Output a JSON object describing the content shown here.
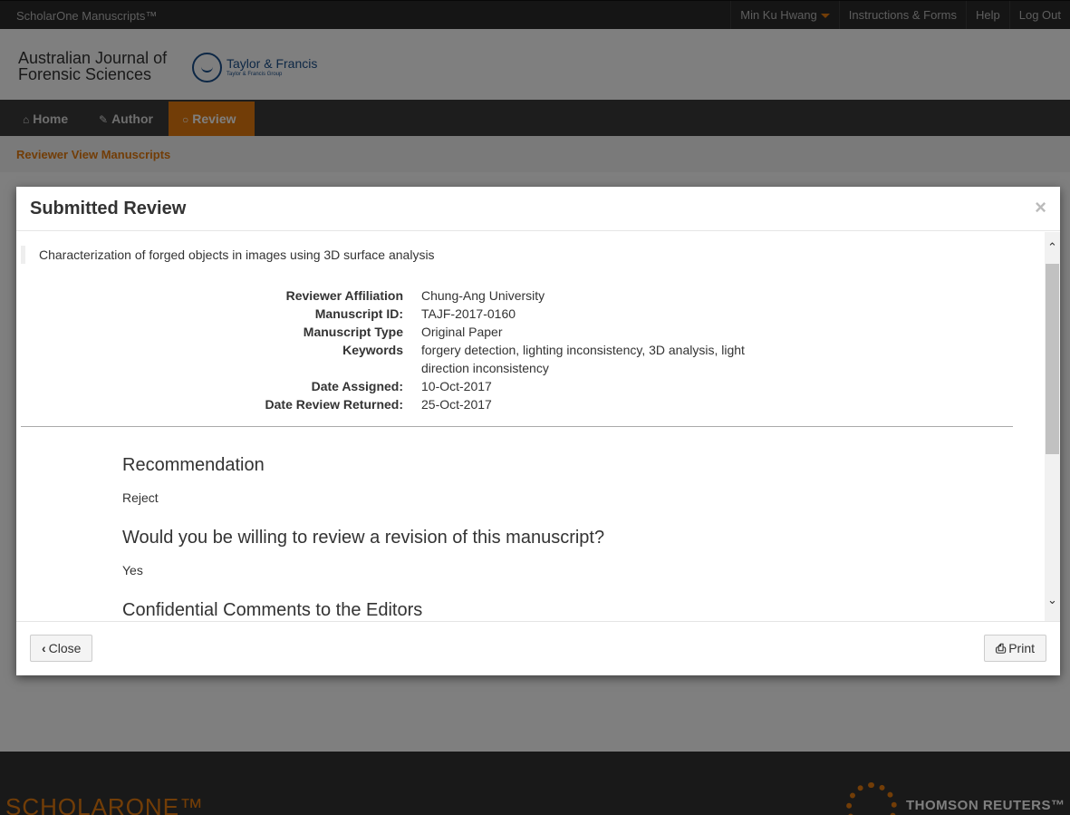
{
  "topbar": {
    "brand": "ScholarOne Manuscripts™",
    "user": "Min Ku Hwang",
    "instructions": "Instructions & Forms",
    "help": "Help",
    "logout": "Log Out"
  },
  "header": {
    "journal_line1": "Australian Journal of",
    "journal_line2": "Forensic Sciences",
    "publisher": "Taylor & Francis",
    "publisher_sub": "Taylor & Francis Group"
  },
  "nav": {
    "home": "Home",
    "author": "Author",
    "review": "Review",
    "breadcrumb": "Reviewer View Manuscripts"
  },
  "modal": {
    "title": "Submitted Review",
    "close_x": "×",
    "manuscript_title": "Characterization of forged objects in images using 3D surface analysis",
    "details": [
      {
        "label": "Reviewer Affiliation",
        "value": "Chung-Ang University"
      },
      {
        "label": "Manuscript ID:",
        "value": "TAJF-2017-0160"
      },
      {
        "label": "Manuscript Type",
        "value": "Original Paper"
      },
      {
        "label": "Keywords",
        "value": "forgery detection, lighting inconsistency, 3D analysis, light direction inconsistency"
      },
      {
        "label": "Date Assigned:",
        "value": "10-Oct-2017"
      },
      {
        "label": "Date Review Returned:",
        "value": "25-Oct-2017"
      }
    ],
    "sections": [
      {
        "heading": "Recommendation",
        "value": "Reject"
      },
      {
        "heading": "Would you be willing to review a revision of this manuscript?",
        "value": "Yes"
      },
      {
        "heading": "Confidential Comments to the Editors",
        "value": ""
      }
    ],
    "close_button": "Close",
    "print_button": "Print"
  },
  "footer": {
    "scholarone": "SCHOLARONE™",
    "thomson": "THOMSON REUTERS™"
  },
  "colors": {
    "accent": "#e47a0e",
    "topbar": "#2a2a2a",
    "navbar": "#3a3a3a"
  }
}
